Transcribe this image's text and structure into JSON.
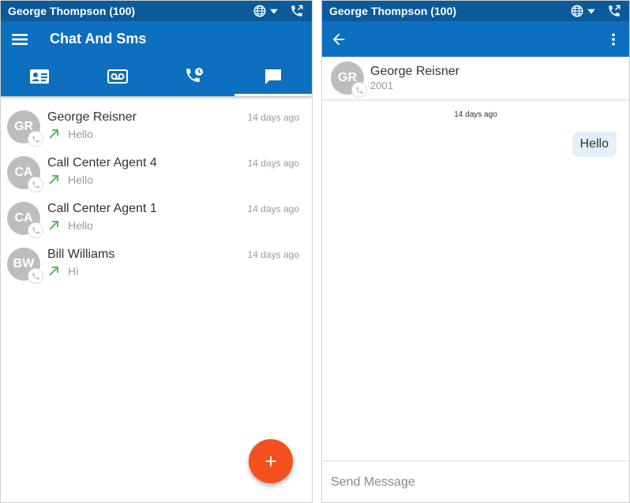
{
  "left": {
    "status_user": "George Thompson (100)",
    "title": "Chat And Sms",
    "tabs": [
      {
        "icon": "contact-card-icon"
      },
      {
        "icon": "voicemail-icon"
      },
      {
        "icon": "call-history-icon"
      },
      {
        "icon": "chat-icon",
        "active": true
      }
    ],
    "conversations": [
      {
        "initials": "GR",
        "name": "George Reisner",
        "time": "14 days ago",
        "preview": "Hello"
      },
      {
        "initials": "CA",
        "name": "Call Center Agent 4",
        "time": "14 days ago",
        "preview": "Hello"
      },
      {
        "initials": "CA",
        "name": "Call Center Agent 1",
        "time": "14 days ago",
        "preview": "Hello"
      },
      {
        "initials": "BW",
        "name": "Bill Williams",
        "time": "14 days ago",
        "preview": "Hi"
      }
    ],
    "fab_label": "+"
  },
  "right": {
    "status_user": "George Thompson (100)",
    "contact": {
      "initials": "GR",
      "name": "George Reisner",
      "ext": "2001"
    },
    "date_divider": "14 days ago",
    "messages": [
      {
        "text": "Hello",
        "direction": "outgoing"
      }
    ],
    "composer": {
      "placeholder": "Send Message"
    }
  },
  "colors": {
    "statusbar": "#0a5a9c",
    "appbar": "#0d6fbf",
    "fab": "#f4511e",
    "avatar": "#bdbdbd",
    "outgoing_arrow": "#4caf50",
    "bubble": "#e3f0fb"
  }
}
